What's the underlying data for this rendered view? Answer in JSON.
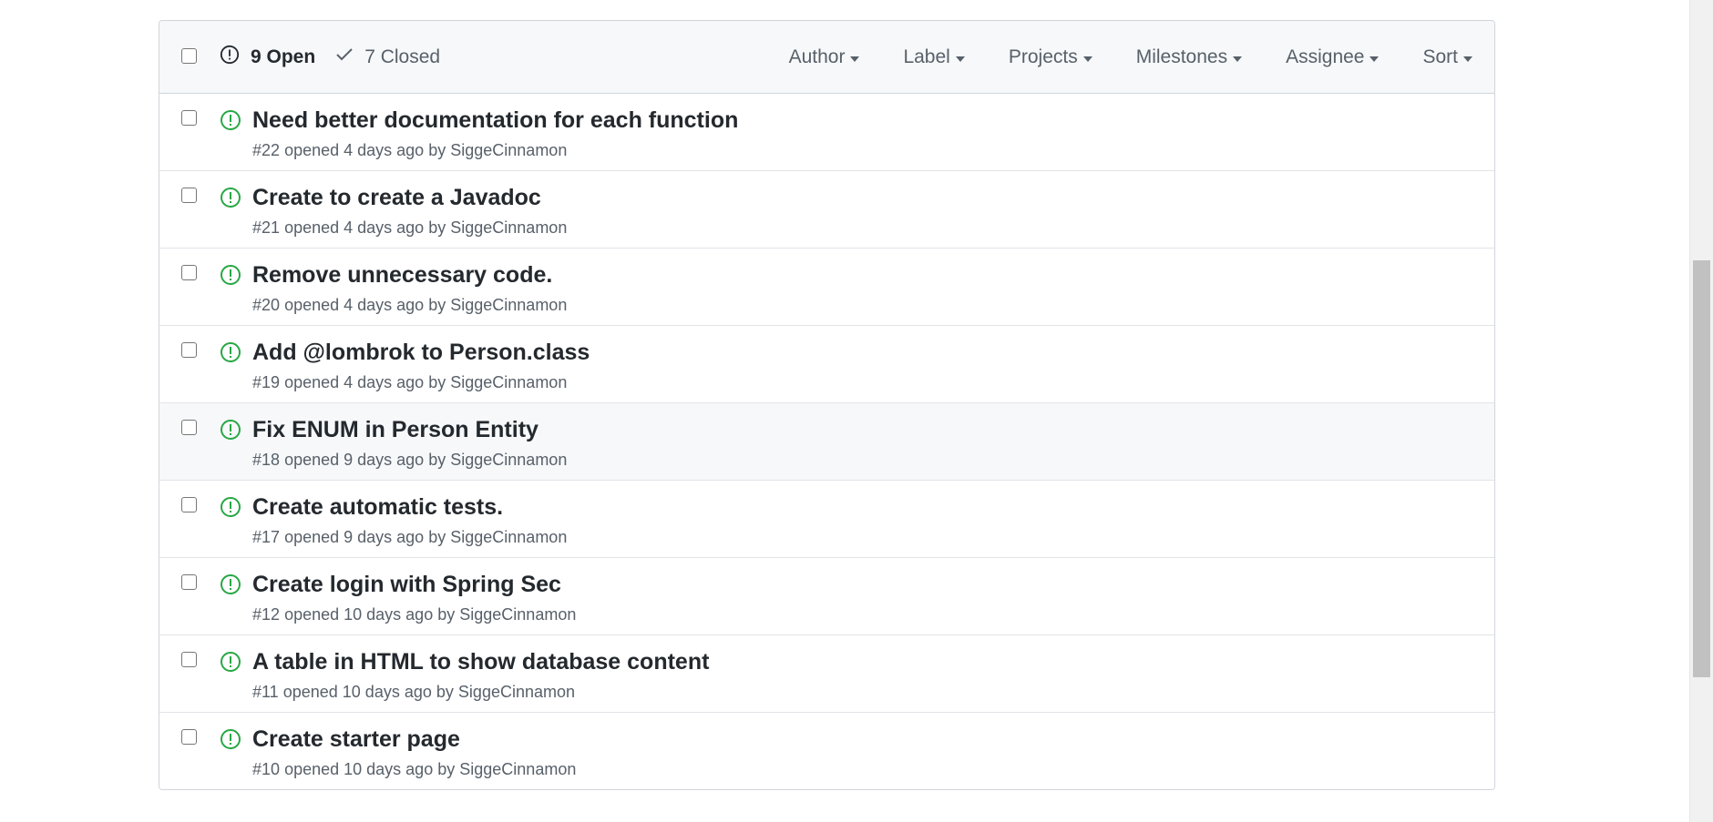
{
  "header": {
    "open_label": "9 Open",
    "closed_label": "7 Closed",
    "open_icon": "issue-opened-icon",
    "closed_icon": "check-icon",
    "filters": [
      {
        "label": "Author"
      },
      {
        "label": "Label"
      },
      {
        "label": "Projects"
      },
      {
        "label": "Milestones"
      },
      {
        "label": "Assignee"
      },
      {
        "label": "Sort"
      }
    ]
  },
  "issues": [
    {
      "title": "Need better documentation for each function",
      "number": "#22",
      "opened": "opened 4 days ago",
      "by": "by",
      "author": "SiggeCinnamon"
    },
    {
      "title": "Create to create a Javadoc",
      "number": "#21",
      "opened": "opened 4 days ago",
      "by": "by",
      "author": "SiggeCinnamon"
    },
    {
      "title": "Remove unnecessary code.",
      "number": "#20",
      "opened": "opened 4 days ago",
      "by": "by",
      "author": "SiggeCinnamon"
    },
    {
      "title": "Add @lombrok to Person.class",
      "number": "#19",
      "opened": "opened 4 days ago",
      "by": "by",
      "author": "SiggeCinnamon"
    },
    {
      "title": "Fix ENUM in Person Entity",
      "number": "#18",
      "opened": "opened 9 days ago",
      "by": "by",
      "author": "SiggeCinnamon"
    },
    {
      "title": "Create automatic tests.",
      "number": "#17",
      "opened": "opened 9 days ago",
      "by": "by",
      "author": "SiggeCinnamon"
    },
    {
      "title": "Create login with Spring Sec",
      "number": "#12",
      "opened": "opened 10 days ago",
      "by": "by",
      "author": "SiggeCinnamon"
    },
    {
      "title": "A table in HTML to show database content",
      "number": "#11",
      "opened": "opened 10 days ago",
      "by": "by",
      "author": "SiggeCinnamon"
    },
    {
      "title": "Create starter page",
      "number": "#10",
      "opened": "opened 10 days ago",
      "by": "by",
      "author": "SiggeCinnamon"
    }
  ],
  "colors": {
    "open_icon": "#28a745",
    "text_primary": "#24292e",
    "text_muted": "#586069",
    "border": "#d1d5da",
    "header_bg": "#f6f8fa"
  }
}
